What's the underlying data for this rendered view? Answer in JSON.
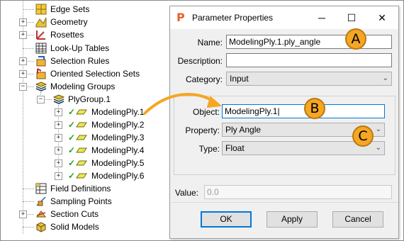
{
  "tree": {
    "items": [
      {
        "label": "Edge Sets",
        "icon": "edge-sets-icon"
      },
      {
        "label": "Geometry",
        "icon": "geometry-icon"
      },
      {
        "label": "Rosettes",
        "icon": "rosettes-icon"
      },
      {
        "label": "Look-Up Tables",
        "icon": "lookup-table-icon"
      },
      {
        "label": "Selection Rules",
        "icon": "selection-rules-icon"
      },
      {
        "label": "Oriented Selection Sets",
        "icon": "oriented-selection-sets-icon"
      },
      {
        "label": "Modeling Groups",
        "icon": "modeling-groups-icon"
      },
      {
        "label": "PlyGroup.1",
        "icon": "plygroup-icon"
      },
      {
        "label": "ModelingPly.1",
        "icon": "modeling-ply-icon"
      },
      {
        "label": "ModelingPly.2",
        "icon": "modeling-ply-icon"
      },
      {
        "label": "ModelingPly.3",
        "icon": "modeling-ply-icon"
      },
      {
        "label": "ModelingPly.4",
        "icon": "modeling-ply-icon"
      },
      {
        "label": "ModelingPly.5",
        "icon": "modeling-ply-icon"
      },
      {
        "label": "ModelingPly.6",
        "icon": "modeling-ply-icon"
      },
      {
        "label": "Field Definitions",
        "icon": "field-definitions-icon"
      },
      {
        "label": "Sampling Points",
        "icon": "sampling-points-icon"
      },
      {
        "label": "Section Cuts",
        "icon": "section-cuts-icon"
      },
      {
        "label": "Solid Models",
        "icon": "solid-models-icon"
      }
    ]
  },
  "dialog": {
    "title": "Parameter Properties",
    "app_icon": "P",
    "minimize": "─",
    "maximize": "☐",
    "close": "✕",
    "name_label": "Name:",
    "name_value": "ModelingPly.1.ply_angle",
    "description_label": "Description:",
    "description_value": "",
    "category_label": "Category:",
    "category_value": "Input",
    "object_label": "Object:",
    "object_value": "ModelingPly.1",
    "property_label": "Property:",
    "property_value": "Ply Angle",
    "type_label": "Type:",
    "type_value": "Float",
    "value_label": "Value:",
    "value_value": "0.0",
    "ok": "OK",
    "apply": "Apply",
    "cancel": "Cancel"
  },
  "callouts": {
    "a": "A",
    "b": "B",
    "c": "C"
  },
  "colors": {
    "callout": "#f5a623",
    "accent": "#0078d7",
    "check": "#2a9d2a"
  }
}
